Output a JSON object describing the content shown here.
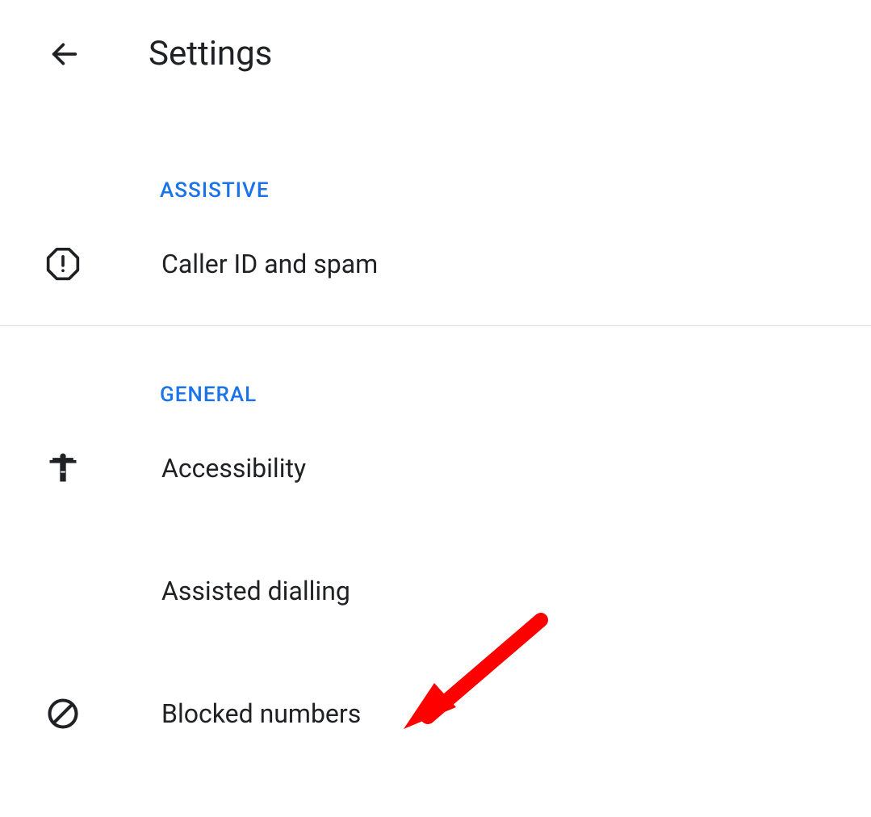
{
  "header": {
    "title": "Settings"
  },
  "sections": {
    "assistive": {
      "label": "ASSISTIVE",
      "items": [
        {
          "label": "Caller ID and spam"
        }
      ]
    },
    "general": {
      "label": "GENERAL",
      "items": [
        {
          "label": "Accessibility"
        },
        {
          "label": "Assisted dialling"
        },
        {
          "label": "Blocked numbers"
        }
      ]
    }
  }
}
